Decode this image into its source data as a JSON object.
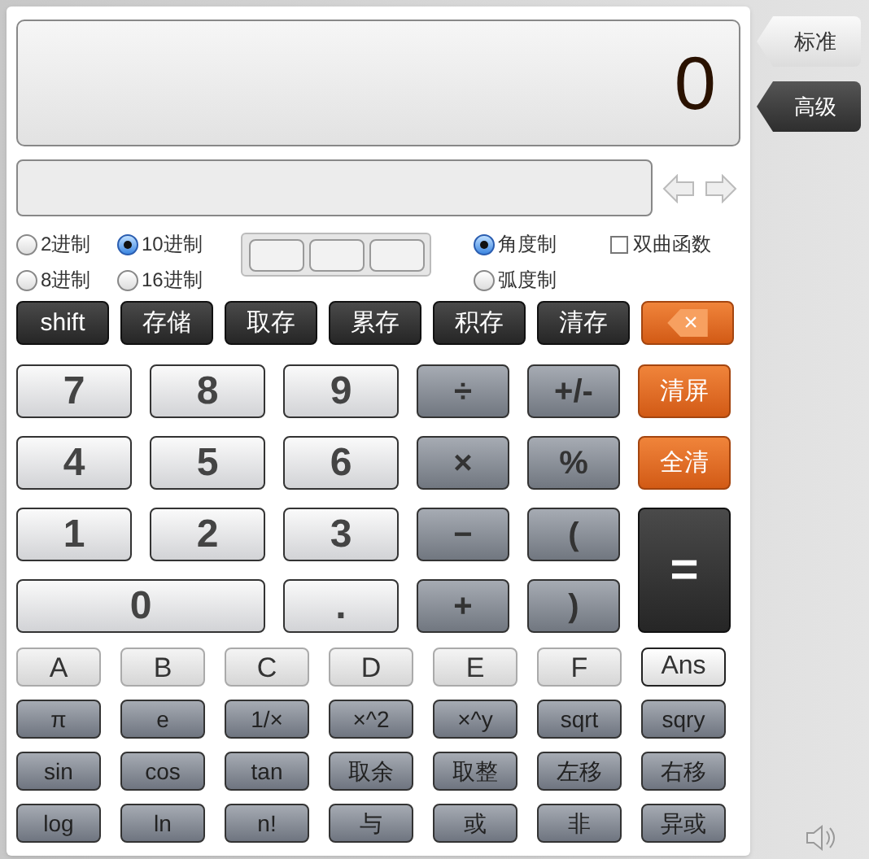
{
  "display": {
    "value": "0"
  },
  "mode_tabs": [
    {
      "label": "标准",
      "selected": false
    },
    {
      "label": "高级",
      "selected": true
    }
  ],
  "base_options": [
    {
      "label": "2进制",
      "selected": false
    },
    {
      "label": "10进制",
      "selected": true
    },
    {
      "label": "8进制",
      "selected": false
    },
    {
      "label": "16进制",
      "selected": false
    }
  ],
  "angle_options": [
    {
      "label": "角度制",
      "selected": true
    },
    {
      "label": "弧度制",
      "selected": false
    }
  ],
  "hyperbolic": {
    "label": "双曲函数",
    "checked": false
  },
  "memory_keys": [
    {
      "label": "shift",
      "kind": "dark"
    },
    {
      "label": "存储",
      "kind": "dark"
    },
    {
      "label": "取存",
      "kind": "dark"
    },
    {
      "label": "累存",
      "kind": "dark"
    },
    {
      "label": "积存",
      "kind": "dark"
    },
    {
      "label": "清存",
      "kind": "dark"
    },
    {
      "label": "×",
      "kind": "backspace"
    }
  ],
  "keypad": [
    {
      "label": "7",
      "kind": "digit"
    },
    {
      "label": "8",
      "kind": "digit"
    },
    {
      "label": "9",
      "kind": "digit"
    },
    {
      "label": "÷",
      "kind": "operator"
    },
    {
      "label": "+/-",
      "kind": "operator"
    },
    {
      "label": "清屏",
      "kind": "orange"
    },
    {
      "label": "4",
      "kind": "digit"
    },
    {
      "label": "5",
      "kind": "digit"
    },
    {
      "label": "6",
      "kind": "digit"
    },
    {
      "label": "×",
      "kind": "operator"
    },
    {
      "label": "%",
      "kind": "operator"
    },
    {
      "label": "全清",
      "kind": "orange"
    },
    {
      "label": "1",
      "kind": "digit"
    },
    {
      "label": "2",
      "kind": "digit"
    },
    {
      "label": "3",
      "kind": "digit"
    },
    {
      "label": "−",
      "kind": "operator"
    },
    {
      "label": "(",
      "kind": "operator"
    },
    {
      "label": "=",
      "kind": "equals"
    },
    {
      "label": "0",
      "kind": "wide-digit"
    },
    {
      "label": ".",
      "kind": "digit"
    },
    {
      "label": "+",
      "kind": "operator"
    },
    {
      "label": ")",
      "kind": "operator"
    }
  ],
  "function_keys": [
    {
      "label": "A",
      "kind": "hex"
    },
    {
      "label": "B",
      "kind": "hex"
    },
    {
      "label": "C",
      "kind": "hex"
    },
    {
      "label": "D",
      "kind": "hex"
    },
    {
      "label": "E",
      "kind": "hex"
    },
    {
      "label": "F",
      "kind": "hex"
    },
    {
      "label": "Ans",
      "kind": "ans"
    },
    {
      "label": "π",
      "kind": "function"
    },
    {
      "label": "e",
      "kind": "function"
    },
    {
      "label": "1/×",
      "kind": "function"
    },
    {
      "label": "×^2",
      "kind": "function"
    },
    {
      "label": "×^y",
      "kind": "function"
    },
    {
      "label": "sqrt",
      "kind": "function"
    },
    {
      "label": "sqry",
      "kind": "function"
    },
    {
      "label": "sin",
      "kind": "function"
    },
    {
      "label": "cos",
      "kind": "function"
    },
    {
      "label": "tan",
      "kind": "function"
    },
    {
      "label": "取余",
      "kind": "function"
    },
    {
      "label": "取整",
      "kind": "function"
    },
    {
      "label": "左移",
      "kind": "function"
    },
    {
      "label": "右移",
      "kind": "function"
    },
    {
      "label": "log",
      "kind": "function"
    },
    {
      "label": "ln",
      "kind": "function"
    },
    {
      "label": "n!",
      "kind": "function"
    },
    {
      "label": "与",
      "kind": "function"
    },
    {
      "label": "或",
      "kind": "function"
    },
    {
      "label": "非",
      "kind": "function"
    },
    {
      "label": "异或",
      "kind": "function"
    }
  ]
}
